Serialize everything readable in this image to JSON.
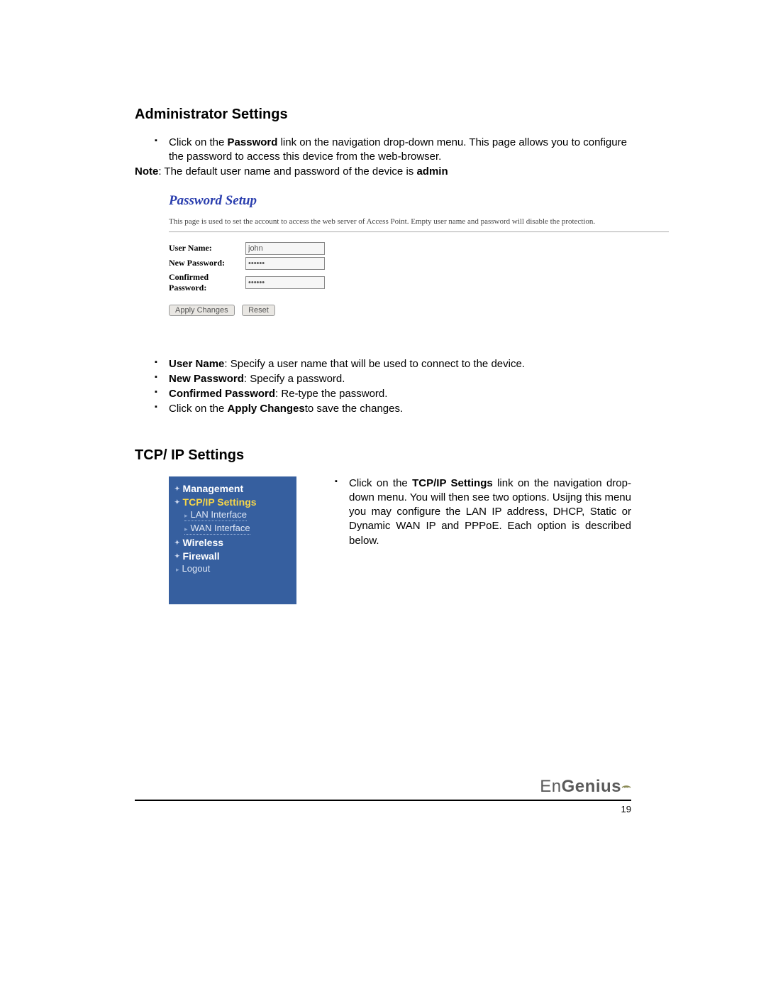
{
  "section1": {
    "heading": "Administrator Settings",
    "intro_pre": "Click on the ",
    "intro_bold": "Password",
    "intro_post": " link on the navigation drop-down menu. This page allows you to configure the password to access this device from the web-browser.",
    "note_pre": "Note",
    "note_mid": ": The default user name and password of the device is ",
    "note_bold": "admin"
  },
  "pwpanel": {
    "title": "Password Setup",
    "desc": "This page is used to set the account to access the web server of Access Point. Empty user name and password will disable the protection.",
    "labels": {
      "user": "User Name:",
      "newpass": "New Password:",
      "confpass": "Confirmed Password:"
    },
    "values": {
      "user": "john",
      "newpass": "••••••",
      "confpass": "••••••"
    },
    "buttons": {
      "apply": "Apply Changes",
      "reset": "Reset"
    }
  },
  "descriptions": {
    "user_bold": "User Name",
    "user_text": ": Specify a user name that will be used to connect to the device.",
    "newpass_bold": "New Password",
    "newpass_text": ": Specify a password.",
    "confpass_bold": "Confirmed Password",
    "confpass_text": ": Re-type the password.",
    "apply_pre": "Click on the ",
    "apply_bold": "Apply Changes",
    "apply_post": "to save the changes."
  },
  "section2": {
    "heading": "TCP/ IP Settings",
    "nav": {
      "management": "Management",
      "tcpip": "TCP/IP Settings",
      "lan": "LAN Interface",
      "wan": "WAN Interface",
      "wireless": "Wireless",
      "firewall": "Firewall",
      "logout": "Logout"
    },
    "para_pre": "Click on the ",
    "para_bold": "TCP/IP Settings",
    "para_post": " link on the navigation drop-down menu. You will then see two options. Usijng this menu you may configure the LAN IP address, DHCP, Static or Dynamic WAN IP and PPPoE. Each option is described below."
  },
  "footer": {
    "brand_en": "En",
    "brand_gen": "Genius",
    "pageno": "19"
  }
}
